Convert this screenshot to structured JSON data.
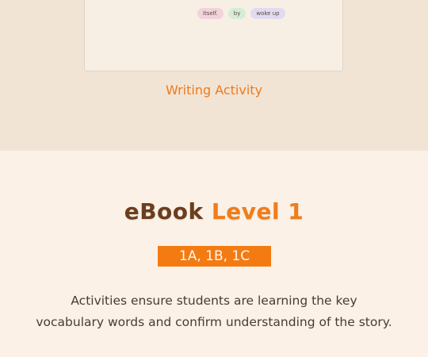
{
  "writing_preview": {
    "chips": [
      "itself.",
      "by",
      "woke up"
    ],
    "caption": "Writing Activity"
  },
  "ebook": {
    "title_prefix": "eBook",
    "title_level": "Level 1",
    "levels_badge": "1A, 1B, 1C",
    "description_line1": "Activities ensure students are learning the key",
    "description_line2": "vocabulary words and confirm understanding of the story."
  }
}
